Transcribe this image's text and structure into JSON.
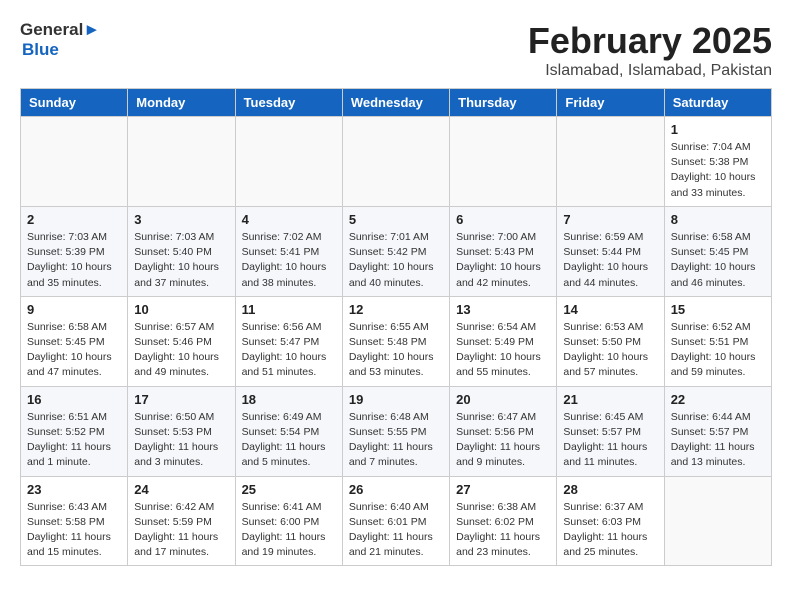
{
  "header": {
    "title": "February 2025",
    "location": "Islamabad, Islamabad, Pakistan"
  },
  "logo": {
    "line1": "General",
    "line2": "Blue"
  },
  "weekdays": [
    "Sunday",
    "Monday",
    "Tuesday",
    "Wednesday",
    "Thursday",
    "Friday",
    "Saturday"
  ],
  "weeks": [
    [
      {
        "day": "",
        "info": ""
      },
      {
        "day": "",
        "info": ""
      },
      {
        "day": "",
        "info": ""
      },
      {
        "day": "",
        "info": ""
      },
      {
        "day": "",
        "info": ""
      },
      {
        "day": "",
        "info": ""
      },
      {
        "day": "1",
        "info": "Sunrise: 7:04 AM\nSunset: 5:38 PM\nDaylight: 10 hours and 33 minutes."
      }
    ],
    [
      {
        "day": "2",
        "info": "Sunrise: 7:03 AM\nSunset: 5:39 PM\nDaylight: 10 hours and 35 minutes."
      },
      {
        "day": "3",
        "info": "Sunrise: 7:03 AM\nSunset: 5:40 PM\nDaylight: 10 hours and 37 minutes."
      },
      {
        "day": "4",
        "info": "Sunrise: 7:02 AM\nSunset: 5:41 PM\nDaylight: 10 hours and 38 minutes."
      },
      {
        "day": "5",
        "info": "Sunrise: 7:01 AM\nSunset: 5:42 PM\nDaylight: 10 hours and 40 minutes."
      },
      {
        "day": "6",
        "info": "Sunrise: 7:00 AM\nSunset: 5:43 PM\nDaylight: 10 hours and 42 minutes."
      },
      {
        "day": "7",
        "info": "Sunrise: 6:59 AM\nSunset: 5:44 PM\nDaylight: 10 hours and 44 minutes."
      },
      {
        "day": "8",
        "info": "Sunrise: 6:58 AM\nSunset: 5:45 PM\nDaylight: 10 hours and 46 minutes."
      }
    ],
    [
      {
        "day": "9",
        "info": "Sunrise: 6:58 AM\nSunset: 5:45 PM\nDaylight: 10 hours and 47 minutes."
      },
      {
        "day": "10",
        "info": "Sunrise: 6:57 AM\nSunset: 5:46 PM\nDaylight: 10 hours and 49 minutes."
      },
      {
        "day": "11",
        "info": "Sunrise: 6:56 AM\nSunset: 5:47 PM\nDaylight: 10 hours and 51 minutes."
      },
      {
        "day": "12",
        "info": "Sunrise: 6:55 AM\nSunset: 5:48 PM\nDaylight: 10 hours and 53 minutes."
      },
      {
        "day": "13",
        "info": "Sunrise: 6:54 AM\nSunset: 5:49 PM\nDaylight: 10 hours and 55 minutes."
      },
      {
        "day": "14",
        "info": "Sunrise: 6:53 AM\nSunset: 5:50 PM\nDaylight: 10 hours and 57 minutes."
      },
      {
        "day": "15",
        "info": "Sunrise: 6:52 AM\nSunset: 5:51 PM\nDaylight: 10 hours and 59 minutes."
      }
    ],
    [
      {
        "day": "16",
        "info": "Sunrise: 6:51 AM\nSunset: 5:52 PM\nDaylight: 11 hours and 1 minute."
      },
      {
        "day": "17",
        "info": "Sunrise: 6:50 AM\nSunset: 5:53 PM\nDaylight: 11 hours and 3 minutes."
      },
      {
        "day": "18",
        "info": "Sunrise: 6:49 AM\nSunset: 5:54 PM\nDaylight: 11 hours and 5 minutes."
      },
      {
        "day": "19",
        "info": "Sunrise: 6:48 AM\nSunset: 5:55 PM\nDaylight: 11 hours and 7 minutes."
      },
      {
        "day": "20",
        "info": "Sunrise: 6:47 AM\nSunset: 5:56 PM\nDaylight: 11 hours and 9 minutes."
      },
      {
        "day": "21",
        "info": "Sunrise: 6:45 AM\nSunset: 5:57 PM\nDaylight: 11 hours and 11 minutes."
      },
      {
        "day": "22",
        "info": "Sunrise: 6:44 AM\nSunset: 5:57 PM\nDaylight: 11 hours and 13 minutes."
      }
    ],
    [
      {
        "day": "23",
        "info": "Sunrise: 6:43 AM\nSunset: 5:58 PM\nDaylight: 11 hours and 15 minutes."
      },
      {
        "day": "24",
        "info": "Sunrise: 6:42 AM\nSunset: 5:59 PM\nDaylight: 11 hours and 17 minutes."
      },
      {
        "day": "25",
        "info": "Sunrise: 6:41 AM\nSunset: 6:00 PM\nDaylight: 11 hours and 19 minutes."
      },
      {
        "day": "26",
        "info": "Sunrise: 6:40 AM\nSunset: 6:01 PM\nDaylight: 11 hours and 21 minutes."
      },
      {
        "day": "27",
        "info": "Sunrise: 6:38 AM\nSunset: 6:02 PM\nDaylight: 11 hours and 23 minutes."
      },
      {
        "day": "28",
        "info": "Sunrise: 6:37 AM\nSunset: 6:03 PM\nDaylight: 11 hours and 25 minutes."
      },
      {
        "day": "",
        "info": ""
      }
    ]
  ]
}
